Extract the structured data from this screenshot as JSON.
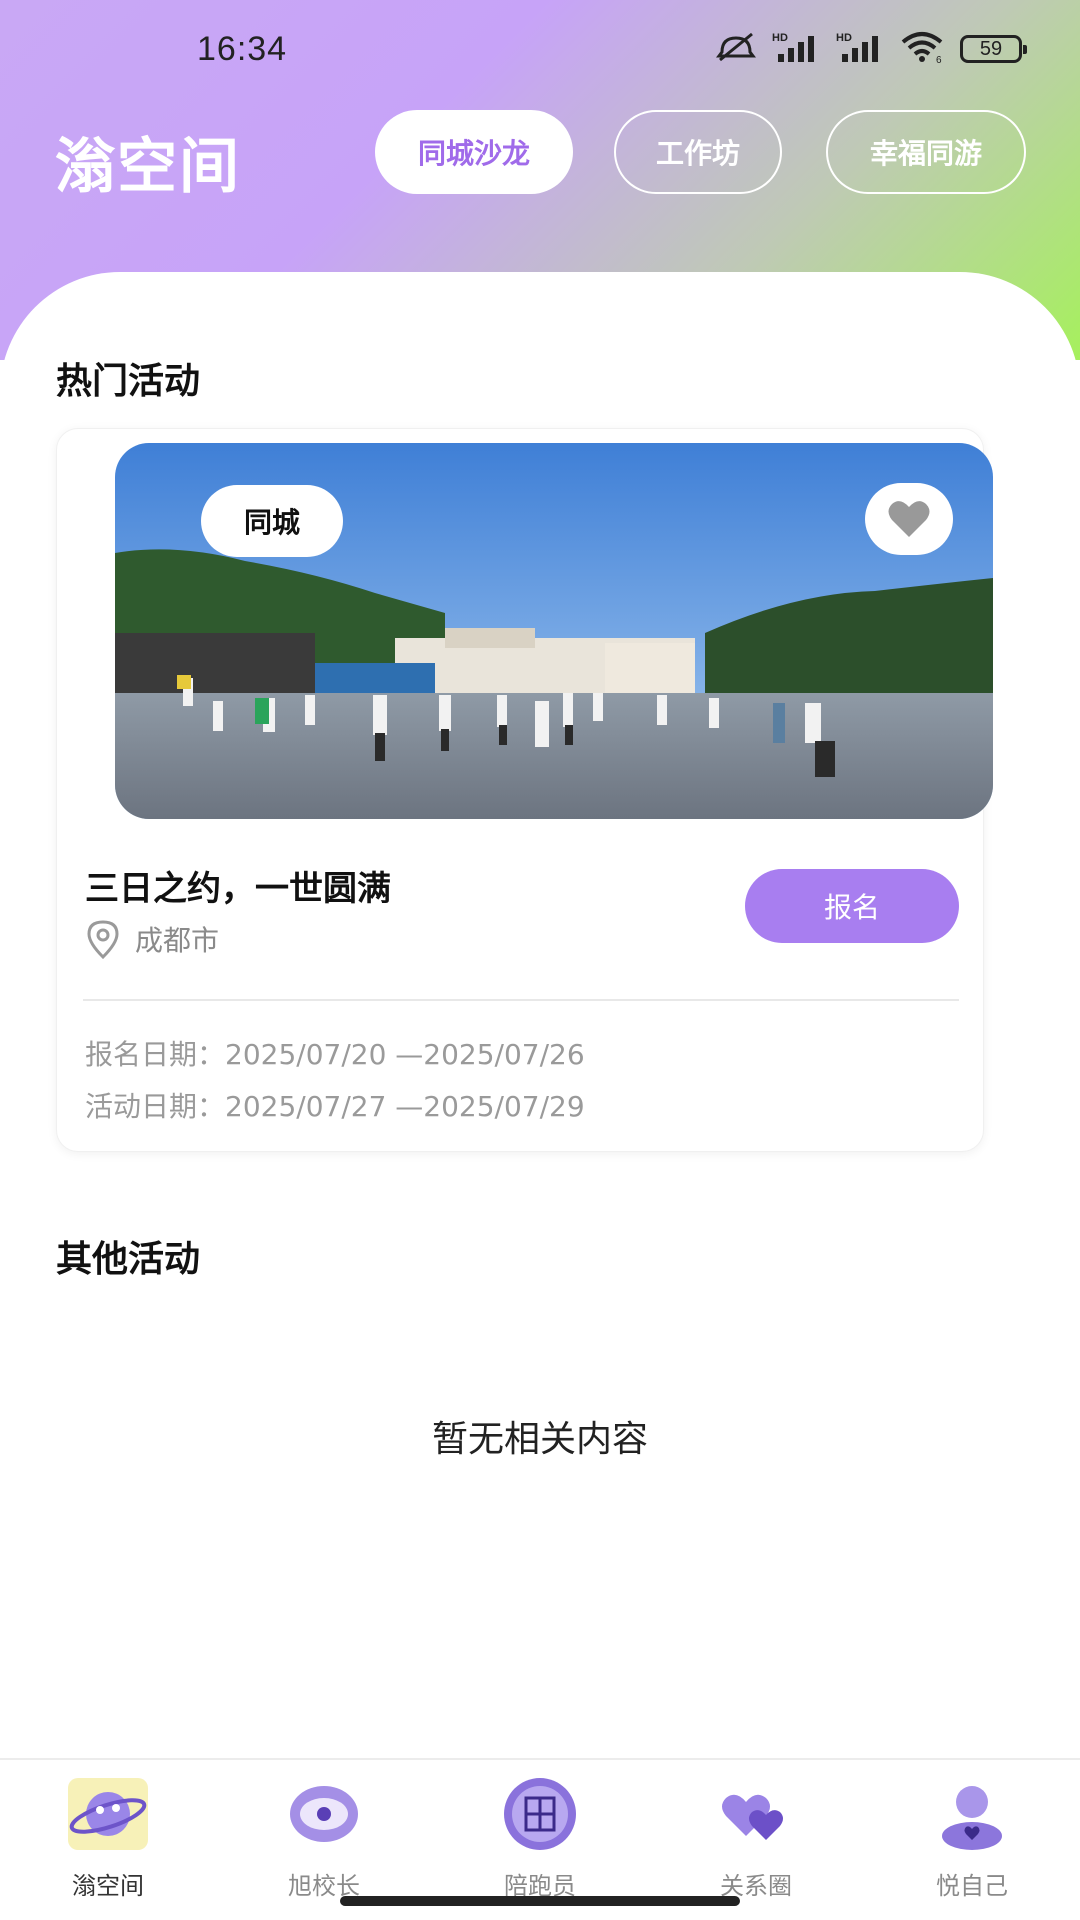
{
  "status_bar": {
    "time": "16:34",
    "battery": "59",
    "icons": [
      "mute-icon",
      "signal-hd-1-icon",
      "signal-hd-2-icon",
      "wifi-icon",
      "battery-icon"
    ]
  },
  "header": {
    "app_title": "滃空间",
    "tabs": [
      {
        "label": "同城沙龙",
        "active": true
      },
      {
        "label": "工作坊",
        "active": false
      },
      {
        "label": "幸福同游",
        "active": false
      }
    ]
  },
  "hot_section": {
    "title": "热门活动",
    "card": {
      "tag": "同城",
      "title": "三日之约，一世圆满",
      "location": "成都市",
      "signup_label": "报名",
      "signup_dates": "报名日期：2025/07/20 —2025/07/26",
      "event_dates": "活动日期：2025/07/27 —2025/07/29"
    }
  },
  "other_section": {
    "title": "其他活动",
    "empty_text": "暂无相关内容"
  },
  "bottom_nav": {
    "items": [
      {
        "label": "滃空间",
        "icon": "planet-icon",
        "active": true
      },
      {
        "label": "旭校长",
        "icon": "eye-icon",
        "active": false
      },
      {
        "label": "陪跑员",
        "icon": "guan-badge-icon",
        "active": false
      },
      {
        "label": "关系圈",
        "icon": "hearts-icon",
        "active": false
      },
      {
        "label": "悦自己",
        "icon": "person-icon",
        "active": false
      }
    ]
  },
  "colors": {
    "accent": "#a87ef0",
    "tab_active_text": "#a06bea",
    "header_gradient_start": "#c9a8f5",
    "header_gradient_end": "#a6f05d"
  }
}
